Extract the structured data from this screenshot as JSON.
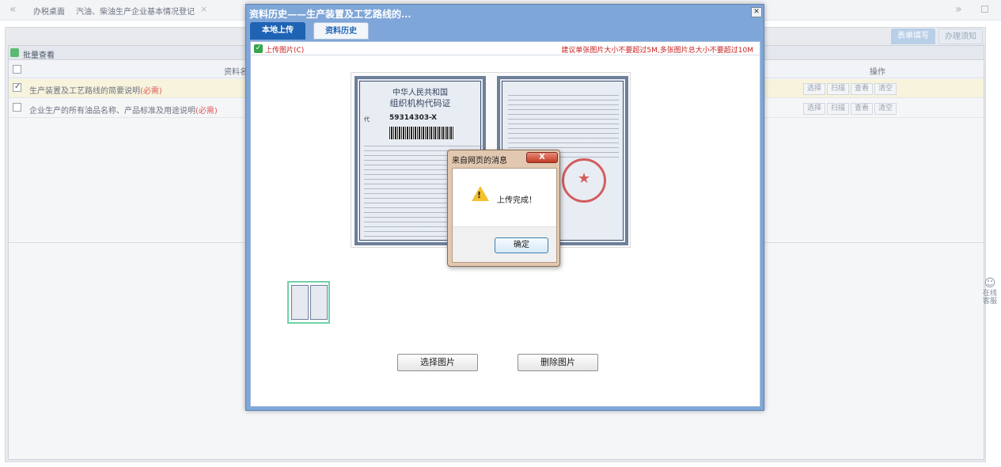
{
  "topbar": {
    "back_icon": "double-left-arrow",
    "tabs": [
      "办税桌面",
      "汽油、柴油生产企业基本情况登记"
    ],
    "close_glyph": "×",
    "forward_icon": "double-right-arrow"
  },
  "form_tabs": [
    "表单填写",
    "办理须知"
  ],
  "grid": {
    "batch_view": "批量查看",
    "col_name": "资料名",
    "col_ops": "操作",
    "rows": [
      {
        "label": "生产装置及工艺路线的简要说明",
        "required": "(必需)",
        "checked": true
      },
      {
        "label": "企业生产的所有油品名称、产品标准及用途说明",
        "required": "(必需)",
        "checked": false
      }
    ],
    "actions": [
      "选择",
      "扫描",
      "查看",
      "清空"
    ]
  },
  "online_service": [
    "在线",
    "客服"
  ],
  "dialog": {
    "title": "资料历史——生产装置及工艺路线的...",
    "close_glyph": "✕",
    "tabs": [
      "本地上传",
      "资料历史"
    ],
    "upload_label": "上传图片(C)",
    "size_hint": "建议单张图片大小不要超过5M,多张图片总大小不要超过10M",
    "select_button": "选择图片",
    "delete_button": "删除图片"
  },
  "certificate": {
    "title_line1": "中华人民共和国",
    "title_line2": "组织机构代码证",
    "code_prefix": "代",
    "code": "59314303-X"
  },
  "alert": {
    "title": "来自网页的消息",
    "close_glyph": "X",
    "message": "上传完成！",
    "ok_button": "确定"
  },
  "colors": {
    "dialog_border": "#7fa6d8",
    "tab_active": "#1f63b4",
    "hint_red": "#c91f1f",
    "required_red": "#e05a5a",
    "row_highlight": "#f7f3dc"
  }
}
